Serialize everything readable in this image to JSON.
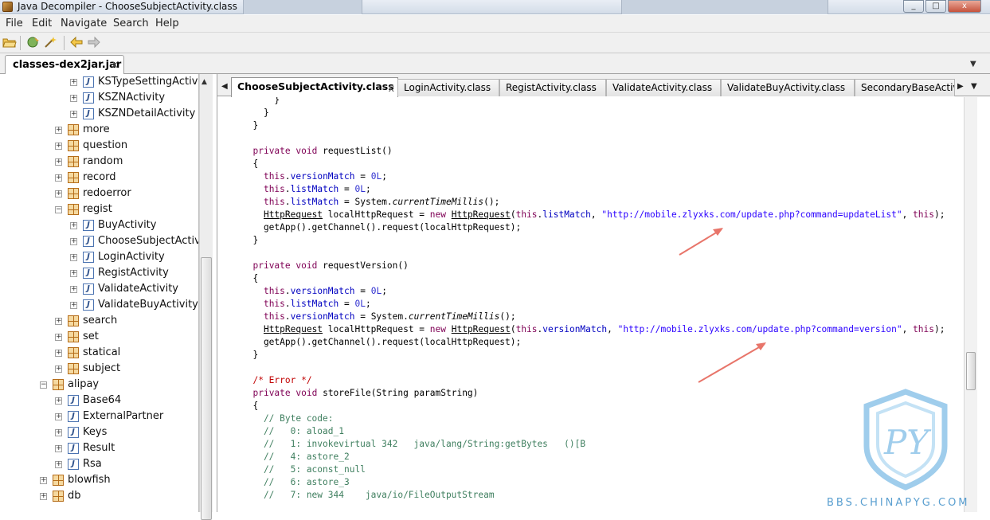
{
  "window": {
    "title": "Java Decompiler - ChooseSubjectActivity.class",
    "controls": [
      "_",
      "□",
      "x"
    ]
  },
  "menu": [
    "File",
    "Edit",
    "Navigate",
    "Search",
    "Help"
  ],
  "file_tab": {
    "label": "classes-dex2jar.jar",
    "close": "x"
  },
  "tree": [
    {
      "label": "KSTypeSettingActivity",
      "icon": "J"
    },
    {
      "label": "KSZNActivity",
      "icon": "J"
    },
    {
      "label": "KSZNDetailActivity",
      "icon": "J"
    },
    {
      "label": "more",
      "icon": "package"
    },
    {
      "label": "question",
      "icon": "package"
    },
    {
      "label": "random",
      "icon": "package"
    },
    {
      "label": "record",
      "icon": "package"
    },
    {
      "label": "redoerror",
      "icon": "package"
    },
    {
      "label": "regist",
      "icon": "package",
      "expanded": true
    },
    {
      "label": "BuyActivity",
      "icon": "J"
    },
    {
      "label": "ChooseSubjectActivity",
      "icon": "J"
    },
    {
      "label": "LoginActivity",
      "icon": "J"
    },
    {
      "label": "RegistActivity",
      "icon": "J"
    },
    {
      "label": "ValidateActivity",
      "icon": "J"
    },
    {
      "label": "ValidateBuyActivity",
      "icon": "J"
    },
    {
      "label": "search",
      "icon": "package"
    },
    {
      "label": "set",
      "icon": "package"
    },
    {
      "label": "statical",
      "icon": "package"
    },
    {
      "label": "subject",
      "icon": "package"
    },
    {
      "label": "alipay",
      "icon": "package",
      "expanded": true
    },
    {
      "label": "Base64",
      "icon": "J"
    },
    {
      "label": "ExternalPartner",
      "icon": "J"
    },
    {
      "label": "Keys",
      "icon": "J"
    },
    {
      "label": "Result",
      "icon": "J"
    },
    {
      "label": "Rsa",
      "icon": "J"
    },
    {
      "label": "blowfish",
      "icon": "package"
    },
    {
      "label": "db",
      "icon": "package"
    }
  ],
  "code_tabs": [
    {
      "label": "ChooseSubjectActivity.class",
      "active": true,
      "close": "x"
    },
    {
      "label": "LoginActivity.class"
    },
    {
      "label": "RegistActivity.class"
    },
    {
      "label": "ValidateActivity.class"
    },
    {
      "label": "ValidateBuyActivity.class"
    },
    {
      "label": "SecondaryBaseActivit"
    }
  ],
  "code": [
    "      }",
    "    }",
    "  }",
    "",
    "  private void requestList()",
    "  {",
    "    this.versionMatch = 0L;",
    "    this.listMatch = 0L;",
    "    this.listMatch = System.currentTimeMillis();",
    "    HttpRequest localHttpRequest = new HttpRequest(this.listMatch, \"http://mobile.zlyxks.com/update.php?command=updateList\", this);",
    "    getApp().getChannel().request(localHttpRequest);",
    "  }",
    "",
    "  private void requestVersion()",
    "  {",
    "    this.versionMatch = 0L;",
    "    this.listMatch = 0L;",
    "    this.versionMatch = System.currentTimeMillis();",
    "    HttpRequest localHttpRequest = new HttpRequest(this.versionMatch, \"http://mobile.zlyxks.com/update.php?command=version\", this);",
    "    getApp().getChannel().request(localHttpRequest);",
    "  }",
    "",
    "  /* Error */",
    "  private void storeFile(String paramString)",
    "  {",
    "    // Byte code:",
    "    //   0: aload_1",
    "    //   1: invokevirtual 342   java/lang/String:getBytes   ()[B",
    "    //   4: astore_2",
    "    //   5: aconst_null",
    "    //   6: astore_3",
    "    //   7: new 344    java/io/FileOutputStream"
  ],
  "watermark": {
    "text": "BBS.CHINAPYG.COM",
    "logo": "PY"
  },
  "annotation_color": "#e8756a"
}
